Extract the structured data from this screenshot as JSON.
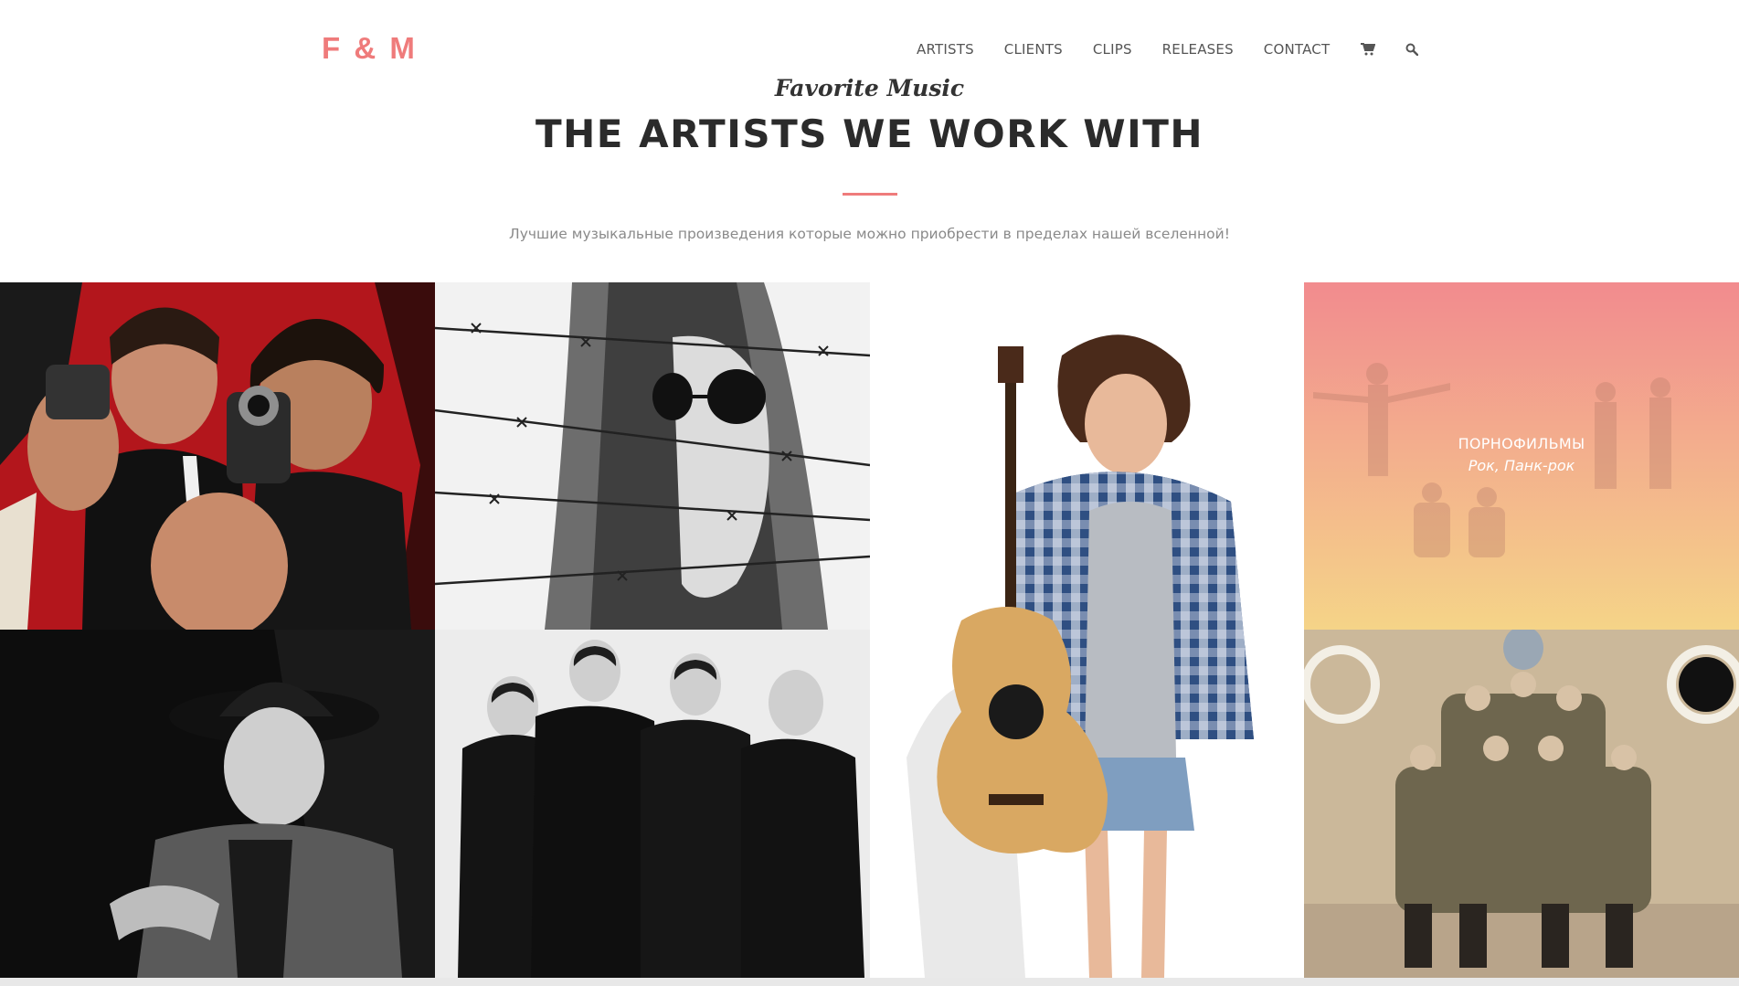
{
  "brand": {
    "logo": "F & M",
    "accent_color": "#ef7b7b"
  },
  "nav": {
    "items": [
      {
        "label": "ARTISTS"
      },
      {
        "label": "CLIENTS"
      },
      {
        "label": "CLIPS"
      },
      {
        "label": "RELEASES"
      },
      {
        "label": "CONTACT"
      }
    ],
    "icons": [
      "cart-icon",
      "search-icon"
    ]
  },
  "hero": {
    "script_title": "Favorite Music",
    "title": "THE ARTISTS WE WORK WITH",
    "subtitle": "Лучшие музыкальные произведения которые можно приобрести в пределах нашей вселенной!"
  },
  "gallery": {
    "tiles": [
      {
        "image": "pulp-fiction-style-duo-photo"
      },
      {
        "image": "barbed-wire-portrait-photo"
      },
      {
        "image": "guitarist-portrait-photo"
      },
      {
        "image": "band-overlay-photo",
        "name": "ПОРНОФИЛЬМЫ",
        "genre": "Рок, Панк-рок"
      },
      {
        "image": "hat-singer-photo"
      },
      {
        "image": "four-man-band-photo"
      },
      {
        "image": "space-band-photo"
      }
    ]
  }
}
